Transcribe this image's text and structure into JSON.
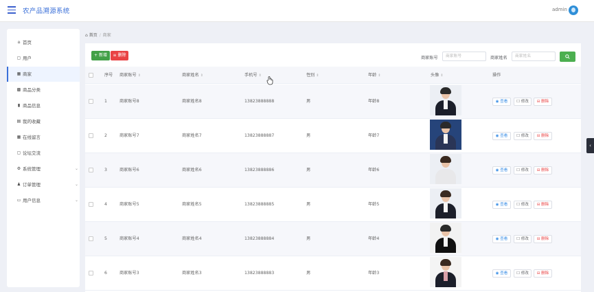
{
  "app": {
    "title": "农产品溯源系统",
    "user": "admin"
  },
  "sidebar": {
    "items": [
      {
        "label": "首页",
        "icon": "home-icon",
        "glyph": "⌂"
      },
      {
        "label": "用户",
        "icon": "user-icon",
        "glyph": "▢"
      },
      {
        "label": "商家",
        "icon": "grid-icon",
        "glyph": "▦",
        "active": true
      },
      {
        "label": "商品分类",
        "icon": "category-icon",
        "glyph": "▩"
      },
      {
        "label": "商品信息",
        "icon": "chart-icon",
        "glyph": "▮"
      },
      {
        "label": "我的收藏",
        "icon": "favorite-icon",
        "glyph": "▤"
      },
      {
        "label": "在线留言",
        "icon": "message-icon",
        "glyph": "▦"
      },
      {
        "label": "论坛交流",
        "icon": "forum-icon",
        "glyph": "▢"
      },
      {
        "label": "系统管理",
        "icon": "settings-icon",
        "glyph": "⚙",
        "expandable": true
      },
      {
        "label": "订单管理",
        "icon": "order-icon",
        "glyph": "♟",
        "expandable": true
      },
      {
        "label": "用户信息",
        "icon": "profile-icon",
        "glyph": "▭",
        "expandable": true
      }
    ]
  },
  "breadcrumb": {
    "home": "首页",
    "separator": "/",
    "current": "商家"
  },
  "toolbar": {
    "add_label": "+ 新增",
    "delete_label": "≡ 删除"
  },
  "filters": {
    "account_label": "商家账号",
    "account_placeholder": "商家账号",
    "name_label": "商家姓名",
    "name_placeholder": "商家姓名"
  },
  "table": {
    "columns": [
      "序号",
      "商家账号",
      "商家姓名",
      "手机号",
      "性别",
      "年龄",
      "头像",
      "操作"
    ],
    "rows": [
      {
        "index": "1",
        "account": "商家账号8",
        "name": "商家姓名8",
        "phone": "13823888888",
        "gender": "男",
        "age": "年龄8"
      },
      {
        "index": "2",
        "account": "商家账号7",
        "name": "商家姓名7",
        "phone": "13823888887",
        "gender": "男",
        "age": "年龄7"
      },
      {
        "index": "3",
        "account": "商家账号6",
        "name": "商家姓名6",
        "phone": "13823888886",
        "gender": "男",
        "age": "年龄6"
      },
      {
        "index": "4",
        "account": "商家账号5",
        "name": "商家姓名5",
        "phone": "13823888885",
        "gender": "男",
        "age": "年龄5"
      },
      {
        "index": "5",
        "account": "商家账号4",
        "name": "商家姓名4",
        "phone": "13823888884",
        "gender": "男",
        "age": "年龄4"
      },
      {
        "index": "6",
        "account": "商家账号3",
        "name": "商家姓名3",
        "phone": "13823888883",
        "gender": "男",
        "age": "年龄3"
      }
    ],
    "actions": {
      "view": "◉ 查看",
      "edit": "☐ 修改",
      "delete": "⊟ 删除"
    }
  },
  "colors": {
    "accent": "#3a6fd8",
    "add": "#43a047",
    "danger": "#e94344",
    "search": "#4caf50"
  }
}
